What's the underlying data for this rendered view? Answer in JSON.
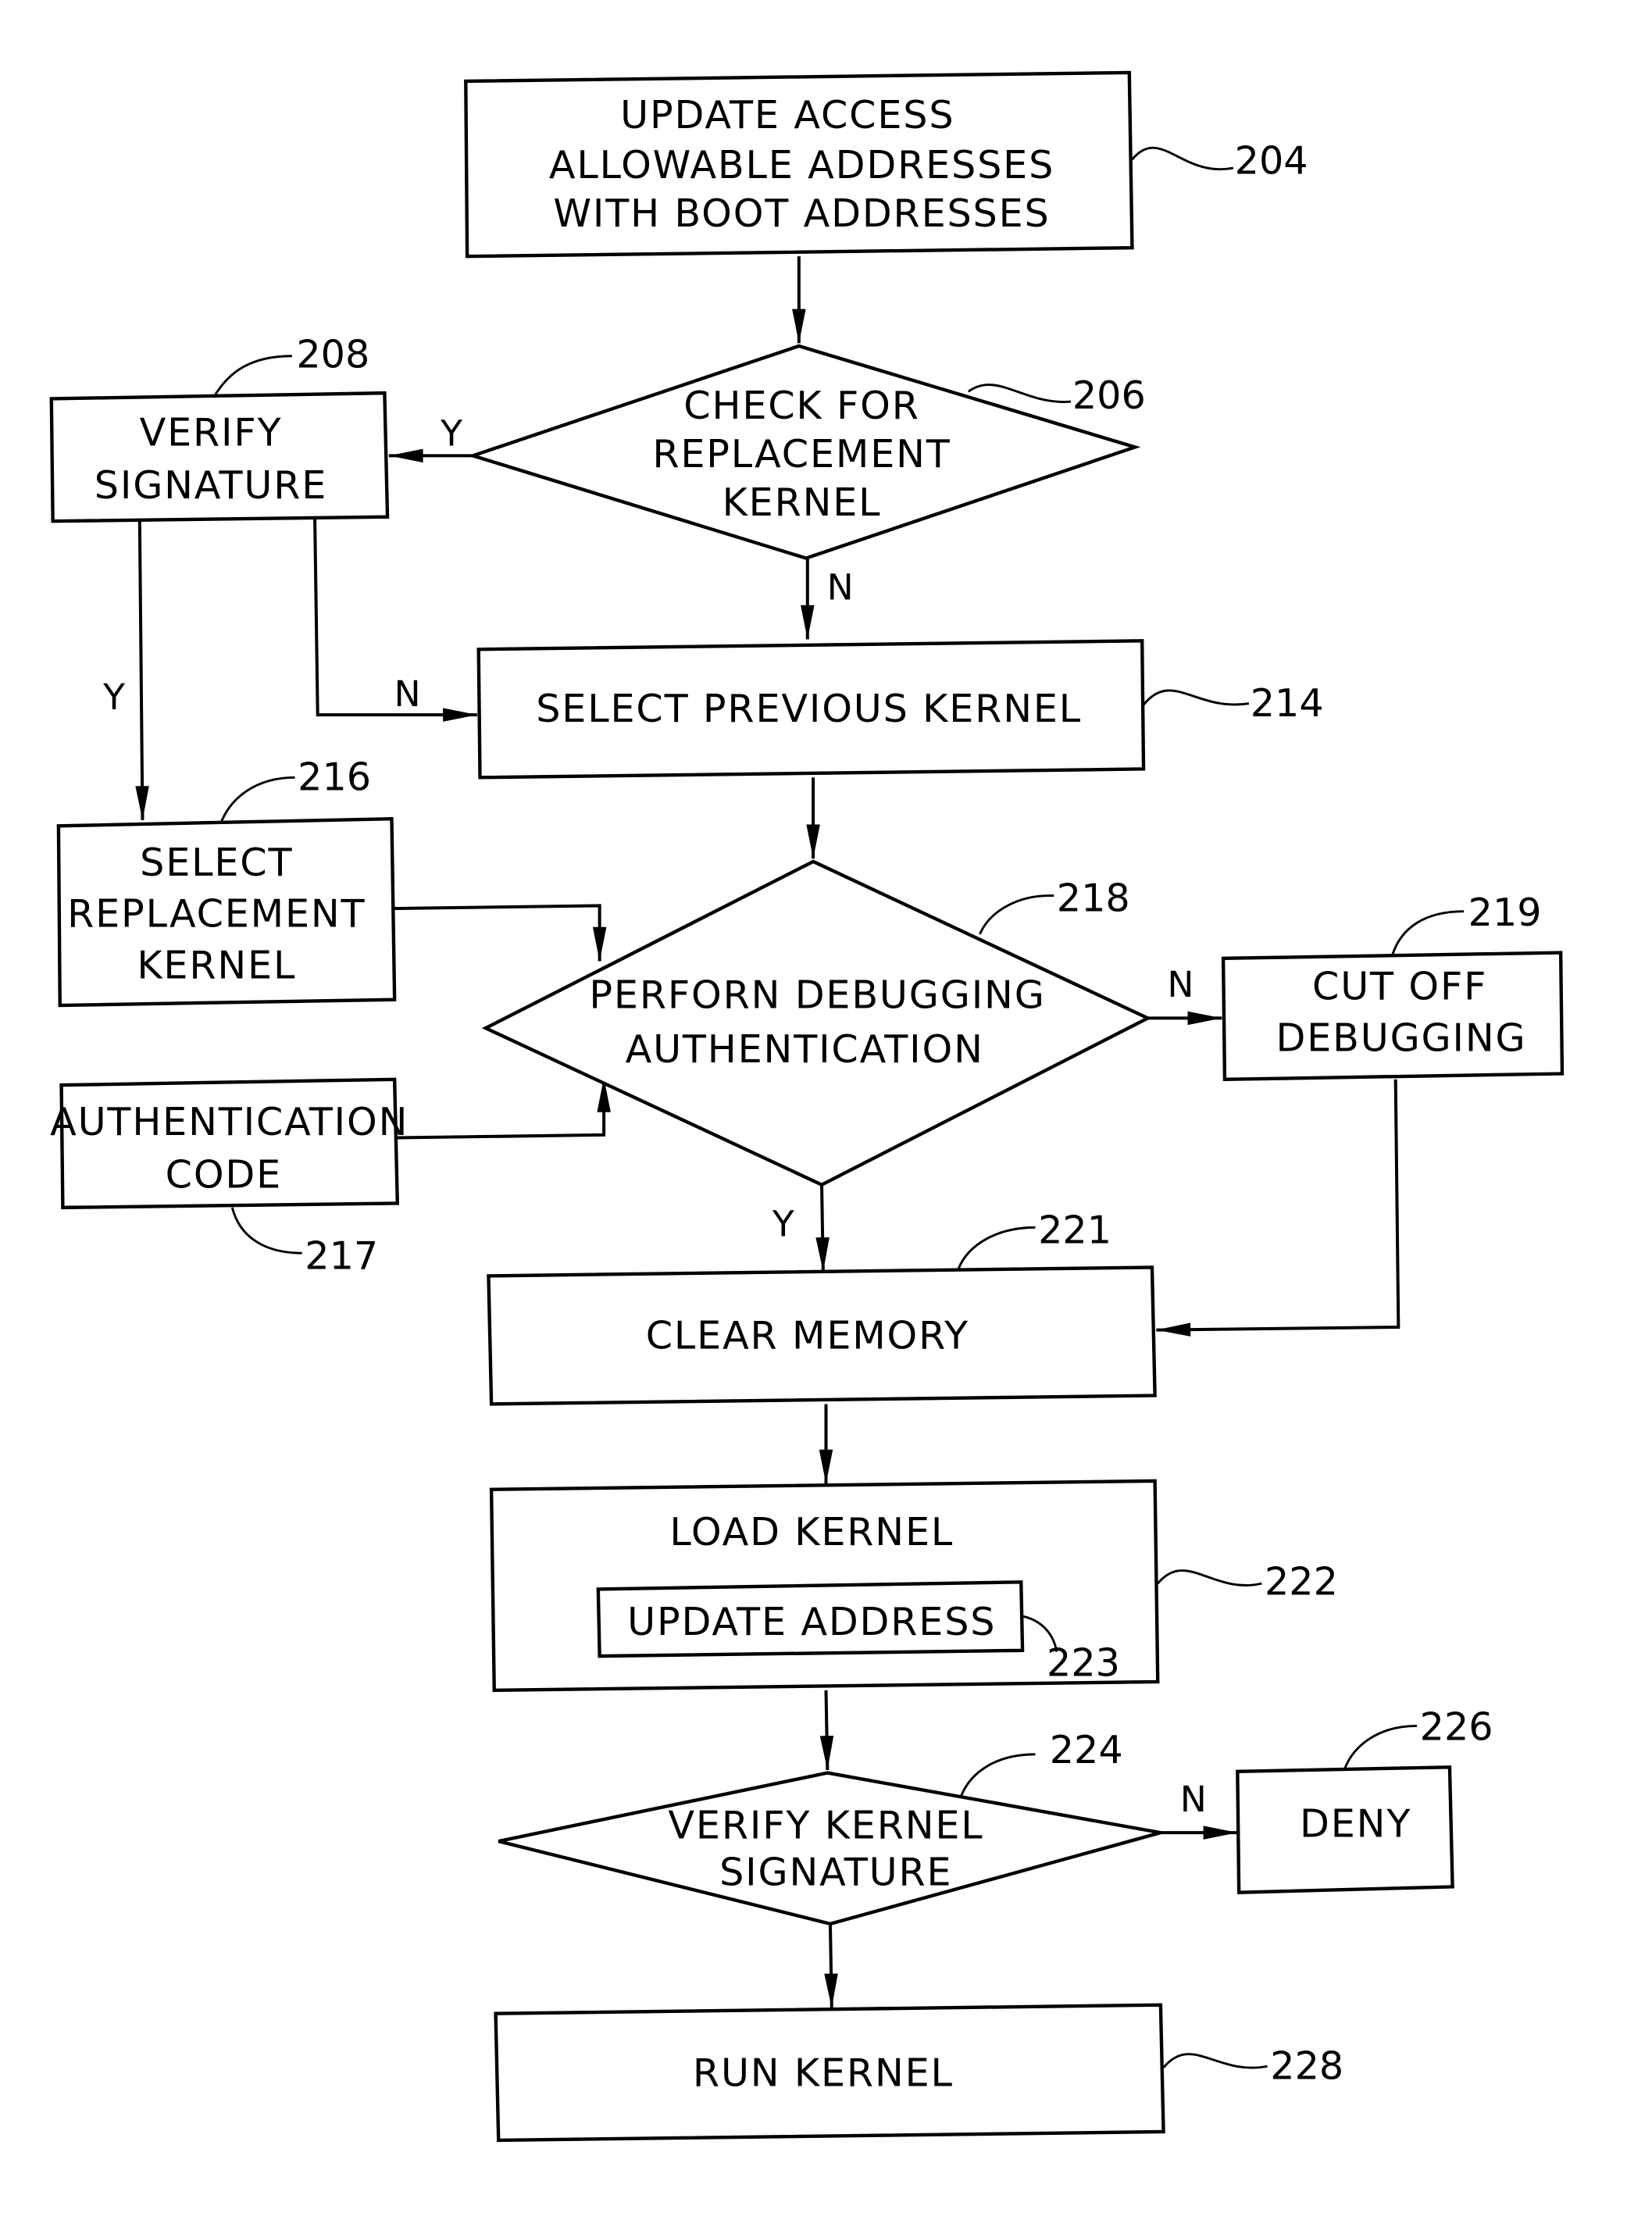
{
  "nodes": {
    "n204": {
      "lines": [
        "UPDATE ACCESS",
        "ALLOWABLE ADDRESSES",
        "WITH BOOT ADDRESSES"
      ],
      "ref": "204"
    },
    "n206": {
      "lines": [
        "CHECK FOR",
        "REPLACEMENT",
        "KERNEL"
      ],
      "ref": "206"
    },
    "n208": {
      "lines": [
        "VERIFY",
        "SIGNATURE"
      ],
      "ref": "208"
    },
    "n214": {
      "lines": [
        "SELECT PREVIOUS KERNEL"
      ],
      "ref": "214"
    },
    "n216": {
      "lines": [
        "SELECT",
        "REPLACEMENT",
        "KERNEL"
      ],
      "ref": "216"
    },
    "n217": {
      "lines": [
        "AUTHENTICATION",
        "CODE"
      ],
      "ref": "217"
    },
    "n218": {
      "lines": [
        "PERFORN DEBUGGING",
        "AUTHENTICATION"
      ],
      "ref": "218"
    },
    "n219": {
      "lines": [
        "CUT OFF",
        "DEBUGGING"
      ],
      "ref": "219"
    },
    "n221": {
      "lines": [
        "CLEAR MEMORY"
      ],
      "ref": "221"
    },
    "n222": {
      "lines": [
        "LOAD KERNEL"
      ],
      "ref": "222"
    },
    "n223": {
      "lines": [
        "UPDATE ADDRESS"
      ],
      "ref": "223"
    },
    "n224": {
      "lines": [
        "VERIFY KERNEL",
        "SIGNATURE"
      ],
      "ref": "224"
    },
    "n226": {
      "lines": [
        "DENY"
      ],
      "ref": "226"
    },
    "n228": {
      "lines": [
        "RUN KERNEL"
      ],
      "ref": "228"
    }
  },
  "edge_labels": {
    "e206_208": "Y",
    "e206_214": "N",
    "e208_216": "Y",
    "e208_214": "N",
    "e218_219": "N",
    "e218_221": "Y",
    "e224_226": "N"
  }
}
